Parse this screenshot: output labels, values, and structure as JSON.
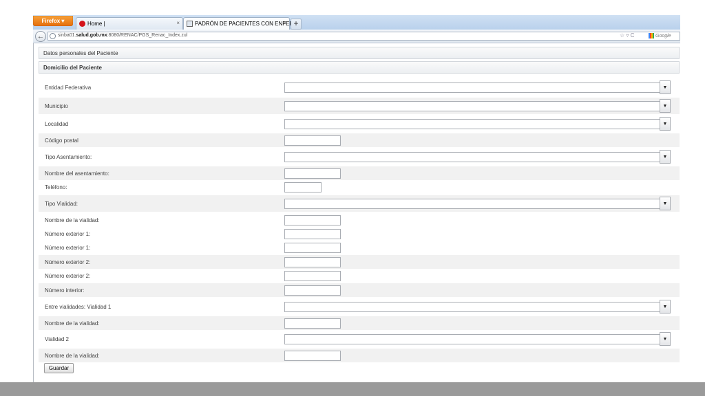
{
  "browser": {
    "menu_button": "Firefox",
    "tabs": [
      {
        "label": "Home |",
        "close": "×"
      },
      {
        "label": "PADRÓN DE PACIENTES CON ENFER...",
        "close": "×"
      }
    ],
    "new_tab": "+",
    "url_host": "sinba01.salud.gob.mx",
    "url_prefix": "sinba01.",
    "url_bold": "salud.gob.mx",
    "url_rest": ":8080/RENAC/PGS_Renac_Index.zul",
    "url_right_icons": "☆ ▿ C",
    "search_engine": "Google",
    "back_icon": "←"
  },
  "page": {
    "section_personal": "Datos personales del Paciente",
    "section_address": "Domicilio del Paciente",
    "fields": [
      {
        "label": "Entidad Federativa",
        "type": "combo",
        "value": ""
      },
      {
        "label": "Municipio",
        "type": "combo",
        "value": ""
      },
      {
        "label": "Localidad",
        "type": "combo",
        "value": ""
      },
      {
        "label": "Código postal",
        "type": "text",
        "value": ""
      },
      {
        "label": "Tipo Asentamiento:",
        "type": "combo",
        "value": ""
      },
      {
        "label": "Nombre del asentamiento:",
        "type": "text",
        "value": ""
      },
      {
        "label": "Teléfono:",
        "type": "text",
        "value": ""
      },
      {
        "label": "Tipo Vialidad:",
        "type": "combo",
        "value": ""
      },
      {
        "label": "Nombre de la vialidad:",
        "type": "text",
        "value": ""
      },
      {
        "label": "Número exterior 1:",
        "type": "text",
        "value": ""
      },
      {
        "label": "Número exterior 1:",
        "type": "text",
        "value": ""
      },
      {
        "label": "Número exterior 2:",
        "type": "text",
        "value": ""
      },
      {
        "label": "Número exterior 2:",
        "type": "text",
        "value": ""
      },
      {
        "label": "Número interior:",
        "type": "text",
        "value": ""
      },
      {
        "label": "Entre vialidades: Vialidad 1",
        "type": "combo",
        "value": ""
      },
      {
        "label": "Nombre de la vialidad:",
        "type": "text",
        "value": ""
      },
      {
        "label": "Vialidad 2",
        "type": "combo",
        "value": ""
      },
      {
        "label": "Nombre de la vialidad:",
        "type": "text",
        "value": ""
      }
    ],
    "save_button": "Guardar",
    "dropdown_glyph": "▼"
  }
}
